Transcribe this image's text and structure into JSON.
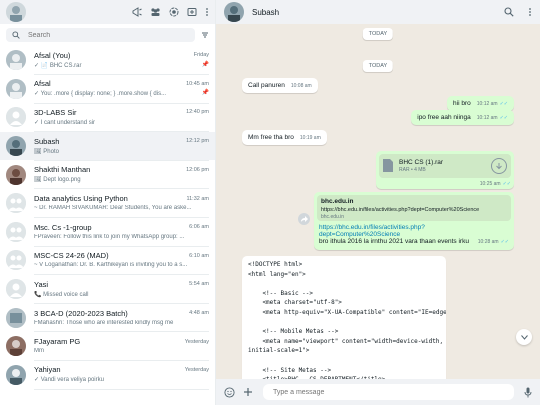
{
  "sidebar": {
    "search_placeholder": "Search",
    "chats": [
      {
        "name": "Afsal (You)",
        "time": "Friday",
        "preview": "✓ 📄 BHC CS.rar",
        "pinned": true
      },
      {
        "name": "Afsal",
        "time": "10:45 am",
        "preview": "✓ You: .more {     display: none; } .more.show {     dis...",
        "pinned": true
      },
      {
        "name": "3D-LABS Sir",
        "time": "12:40 pm",
        "preview": "✓ I cant understand sir",
        "pinned": false
      },
      {
        "name": "Subash",
        "time": "12:12 pm",
        "preview": "🖼 Photo",
        "pinned": false
      },
      {
        "name": "Shakthi Manthan",
        "time": "12:06 pm",
        "preview": "🖼 Dept logo.png",
        "pinned": false
      },
      {
        "name": "Data analytics Using Python",
        "time": "11:32 am",
        "preview": "~ Dr. RAMAH SIVAKUMAR: Dear Students, You are aske...",
        "pinned": false
      },
      {
        "name": "Msc. Cs -1-group",
        "time": "6:06 am",
        "preview": "FPraveen: Follow this link to join my WhatsApp group: ...",
        "pinned": false
      },
      {
        "name": "MSC-CS 24-26 (MAD)",
        "time": "6:10 am",
        "preview": "~ V Loganathan: Dr. B. Karthikeyan is inviting you to a s...",
        "pinned": false
      },
      {
        "name": "Yasi",
        "time": "5:54 am",
        "preview": "📞 Missed voice call",
        "pinned": false
      },
      {
        "name": "3 BCA-D (2020-2023 Batch)",
        "time": "4:48 am",
        "preview": "FMahashri: Those who are interested kindly msg me",
        "pinned": false
      },
      {
        "name": "FJayaram PG",
        "time": "Yesterday",
        "preview": "Mm",
        "pinned": false
      },
      {
        "name": "Yahiyan",
        "time": "Yesterday",
        "preview": "✓ Vandi vera veliya poirku",
        "pinned": false
      }
    ]
  },
  "conversation": {
    "contact_name": "Subash",
    "day_labels": [
      "TODAY",
      "TODAY"
    ],
    "messages": {
      "m1": {
        "text": "Call panuren",
        "time": "10:08 am"
      },
      "m2": {
        "text": "hii bro",
        "time": "10:12 am"
      },
      "m3": {
        "text": "ipo free aah niinga",
        "time": "10:12 am"
      },
      "m4": {
        "text": "Mm free tha bro",
        "time": "10:19 am"
      },
      "file": {
        "name": "BHC CS (1).rar",
        "size": "RAR • 4 MB",
        "time": "10:25 am"
      },
      "link": {
        "site": "bhc.edu.in",
        "url_preview": "https://bhc.edu.in/files/activities.php?dept=Computer%20Science",
        "domain": "bhc.edu.in",
        "link_line1": "https://bhc.edu.in/files/activities.php?",
        "link_line2": "dept=Computer%20Science",
        "text": "bro ithula 2016 la irnthu 2021 vara thaan events irku",
        "time": "10:28 am"
      },
      "code": "<!DOCTYPE html>\n<html lang=\"en\">\n\n    <!-- Basic -->\n    <meta charset=\"utf-8\">\n    <meta http-equiv=\"X-UA-Compatible\" content=\"IE=edge\">\n\n    <!-- Mobile Metas -->\n    <meta name=\"viewport\" content=\"width=device-width,\ninitial-scale=1\">\n\n    <!-- Site Metas -->\n    <title>BHC - CS DEPARTMENT</title>\n    <meta name=\"keywords\" content=\"\">\n    <meta name=\"description\" content=\"\">"
    },
    "composer_placeholder": "Type a message"
  }
}
